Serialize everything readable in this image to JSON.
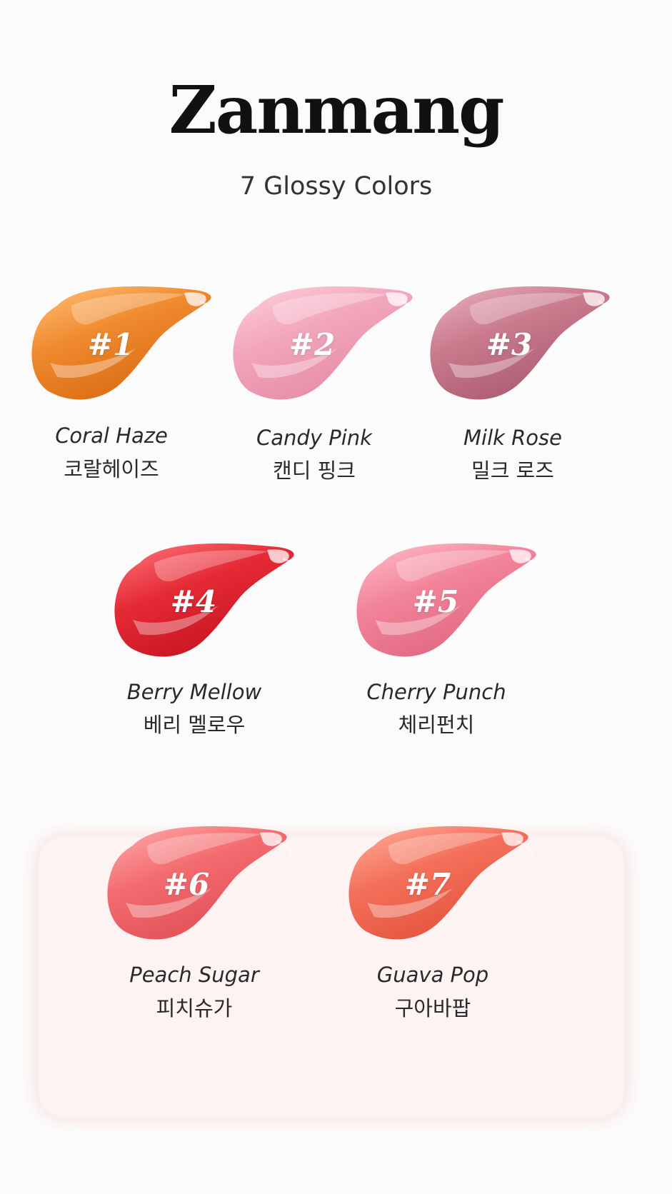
{
  "header": {
    "title": "Zanmang",
    "subtitle": "7 Glossy Colors"
  },
  "shades": [
    {
      "number": "#1",
      "name_en": "Coral Haze",
      "name_ko": "코랄헤이즈",
      "color": "#f08a2e",
      "highlight": "#ffc27a",
      "shadow": "#d86a12"
    },
    {
      "number": "#2",
      "name_en": "Candy Pink",
      "name_ko": "캔디 핑크",
      "color": "#f2a6bc",
      "highlight": "#ffd2de",
      "shadow": "#e58aa5"
    },
    {
      "number": "#3",
      "name_en": "Milk Rose",
      "name_ko": "밀크 로즈",
      "color": "#c97a8d",
      "highlight": "#eab3c0",
      "shadow": "#a95a6e"
    },
    {
      "number": "#4",
      "name_en": "Berry Mellow",
      "name_ko": "베리 멜로우",
      "color": "#e52a35",
      "highlight": "#ff7a80",
      "shadow": "#c41420"
    },
    {
      "number": "#5",
      "name_en": "Cherry Punch",
      "name_ko": "체리펀치",
      "color": "#f2849a",
      "highlight": "#ffc0cc",
      "shadow": "#e06680"
    },
    {
      "number": "#6",
      "name_en": "Peach Sugar",
      "name_ko": "피치슈가",
      "color": "#f36c70",
      "highlight": "#ffaeae",
      "shadow": "#e04e55"
    },
    {
      "number": "#7",
      "name_en": "Guava Pop",
      "name_ko": "구아바팝",
      "color": "#f4705a",
      "highlight": "#ffb09e",
      "shadow": "#e2523c"
    }
  ]
}
